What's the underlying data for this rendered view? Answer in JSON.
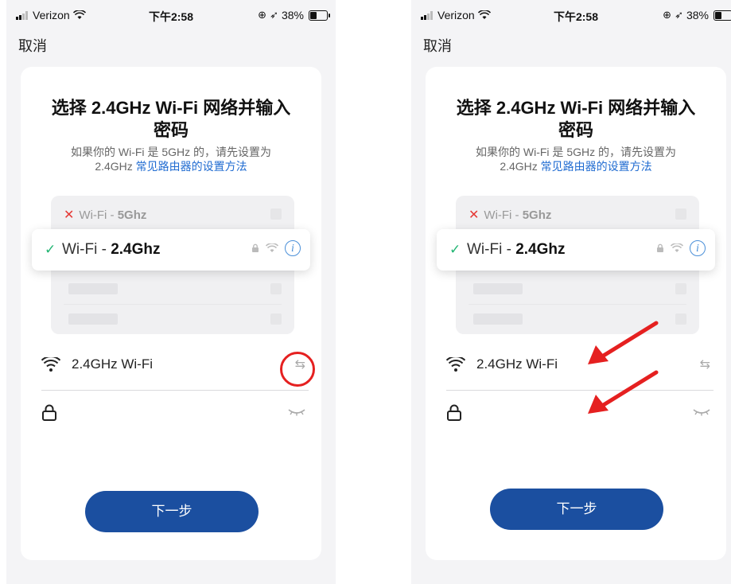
{
  "status_bar": {
    "carrier": "Verizon",
    "time": "下午2:58",
    "battery": "38%"
  },
  "nav": {
    "cancel_label": "取消"
  },
  "page": {
    "title_line1": "选择 2.4GHz Wi-Fi 网络并输入",
    "title_line2": "密码",
    "subtitle_line1": "如果你的 Wi-Fi 是 5GHz 的，请先设置为",
    "subtitle_prefix": "2.4GHz ",
    "subtitle_link": "常见路由器的设置方法"
  },
  "networks": {
    "bad": {
      "label": "Wi-Fi - ",
      "band": "5Ghz"
    },
    "good": {
      "label": "Wi-Fi - ",
      "band": "2.4Ghz"
    }
  },
  "form": {
    "ssid_value": "2.4GHz Wi-Fi",
    "password_value": ""
  },
  "buttons": {
    "next_label": "下一步"
  },
  "icons": {
    "wifi": "wifi-icon",
    "lock": "lock-icon",
    "swap": "swap-icon",
    "eye": "eye-closed-icon",
    "info": "info-icon"
  },
  "colors": {
    "primary_button": "#1b4fa0",
    "link": "#1f6bd1",
    "check": "#22b573",
    "error_x": "#e53935",
    "annotation": "#e52020"
  }
}
